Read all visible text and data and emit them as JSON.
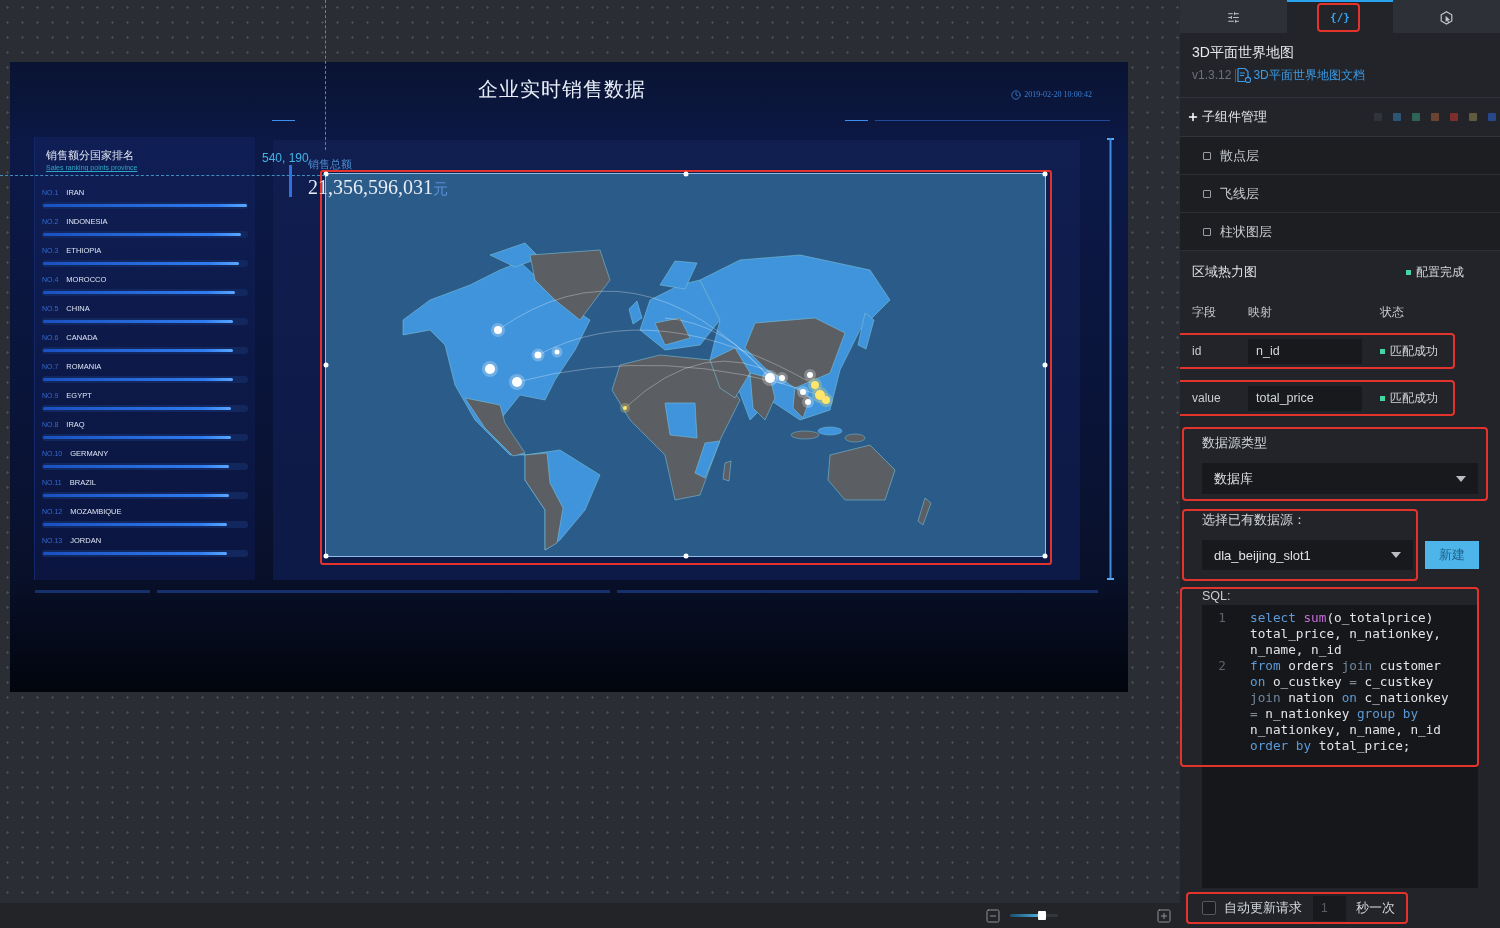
{
  "canvas": {
    "guide": {
      "position_label": "540, 190"
    },
    "screen": {
      "title": "企业实时销售数据",
      "timestamp": "2019-02-20 10:00:42",
      "ranking": {
        "title": "销售额分国家排名",
        "subtitle": "Sales ranking points province",
        "rows": [
          {
            "rank": "NO.1",
            "country": "IRAN",
            "level": 1.0
          },
          {
            "rank": "NO.2",
            "country": "INDONESIA",
            "level": 0.97
          },
          {
            "rank": "NO.3",
            "country": "ETHIOPIA",
            "level": 0.96
          },
          {
            "rank": "NO.4",
            "country": "MOROCCO",
            "level": 0.94
          },
          {
            "rank": "NO.5",
            "country": "CHINA",
            "level": 0.93
          },
          {
            "rank": "NO.6",
            "country": "CANADA",
            "level": 0.93
          },
          {
            "rank": "NO.7",
            "country": "ROMANIA",
            "level": 0.93
          },
          {
            "rank": "NO.9",
            "country": "EGYPT",
            "level": 0.92
          },
          {
            "rank": "NO.8",
            "country": "IRAQ",
            "level": 0.92
          },
          {
            "rank": "NO.10",
            "country": "GERMANY",
            "level": 0.91
          },
          {
            "rank": "NO.11",
            "country": "BRAZIL",
            "level": 0.91
          },
          {
            "rank": "NO.12",
            "country": "MOZAMBIQUE",
            "level": 0.9
          },
          {
            "rank": "NO.13",
            "country": "JORDAN",
            "level": 0.9
          }
        ]
      },
      "total": {
        "label": "销售总额",
        "value": "21,356,596,031",
        "unit": "元"
      },
      "map": {
        "selected": true,
        "highlighted": true
      }
    },
    "zoom": {
      "level": 0.67
    }
  },
  "panel": {
    "tabs": [
      {
        "selected": false,
        "highlighted": false
      },
      {
        "label": "{/}",
        "selected": true,
        "highlighted": true
      },
      {
        "selected": false,
        "highlighted": false
      }
    ],
    "component": {
      "title": "3D平面世界地图",
      "version": "v1.3.12",
      "doc_link": "3D平面世界地图文档"
    },
    "subcomponents": {
      "label": "子组件管理",
      "swatches": [
        {
          "color": "#303339"
        },
        {
          "color": "#2d5573"
        },
        {
          "color": "#2f6357"
        },
        {
          "color": "#6b4431"
        },
        {
          "color": "#7d2d2d"
        },
        {
          "color": "#5f5b3f"
        },
        {
          "color": "#26478a"
        }
      ],
      "layers": [
        {
          "name": "散点层",
          "checked": false
        },
        {
          "name": "飞线层",
          "checked": false
        },
        {
          "name": "柱状图层",
          "checked": false
        }
      ]
    },
    "heatmap": {
      "title": "区域热力图",
      "status": {
        "text": "配置完成",
        "kind": "success"
      }
    },
    "columns": [
      "字段",
      "映射",
      "状态"
    ],
    "fields": [
      {
        "name": "id",
        "mapping": "n_id",
        "status": "匹配成功",
        "kind": "success",
        "highlighted": true
      },
      {
        "name": "value",
        "mapping": "total_price",
        "status": "匹配成功",
        "kind": "success",
        "highlighted": true
      }
    ],
    "source_type": {
      "label": "数据源类型",
      "value": "数据库",
      "highlighted": true
    },
    "source": {
      "label": "选择已有数据源：",
      "value": "dla_beijing_slot1",
      "button": "新建",
      "highlighted": true
    },
    "sql": {
      "label": "SQL:",
      "highlighted": true,
      "lines": [
        {
          "number": "1",
          "tokens": [
            {
              "kind": "keyword",
              "text": "select"
            },
            {
              "kind": "function",
              "text": " sum"
            },
            {
              "kind": "plain",
              "text": "(o_totalprice) total_price, n_nationkey, n_name, n_id"
            }
          ]
        },
        {
          "number": "2",
          "tokens": [
            {
              "kind": "keyword",
              "text": "from"
            },
            {
              "kind": "plain",
              "text": " orders "
            },
            {
              "kind": "keyword_alt",
              "text": "join"
            },
            {
              "kind": "plain",
              "text": " customer "
            },
            {
              "kind": "keyword",
              "text": "on"
            },
            {
              "kind": "plain",
              "text": " o_custkey "
            },
            {
              "kind": "operator",
              "text": "="
            },
            {
              "kind": "plain",
              "text": " c_custkey "
            },
            {
              "kind": "keyword_alt",
              "text": "join"
            },
            {
              "kind": "plain",
              "text": " nation "
            },
            {
              "kind": "keyword",
              "text": "on"
            },
            {
              "kind": "plain",
              "text": " c_nationkey "
            },
            {
              "kind": "operator",
              "text": "="
            },
            {
              "kind": "plain",
              "text": " n_nationkey "
            },
            {
              "kind": "keyword",
              "text": "group by"
            },
            {
              "kind": "plain",
              "text": " n_nationkey, n_name, n_id "
            },
            {
              "kind": "keyword",
              "text": "order by"
            },
            {
              "kind": "plain",
              "text": " total_price;"
            }
          ]
        }
      ]
    },
    "auto_update": {
      "label": "自动更新请求",
      "checked": false,
      "interval": "1",
      "unit": "秒一次",
      "highlighted": true
    }
  }
}
